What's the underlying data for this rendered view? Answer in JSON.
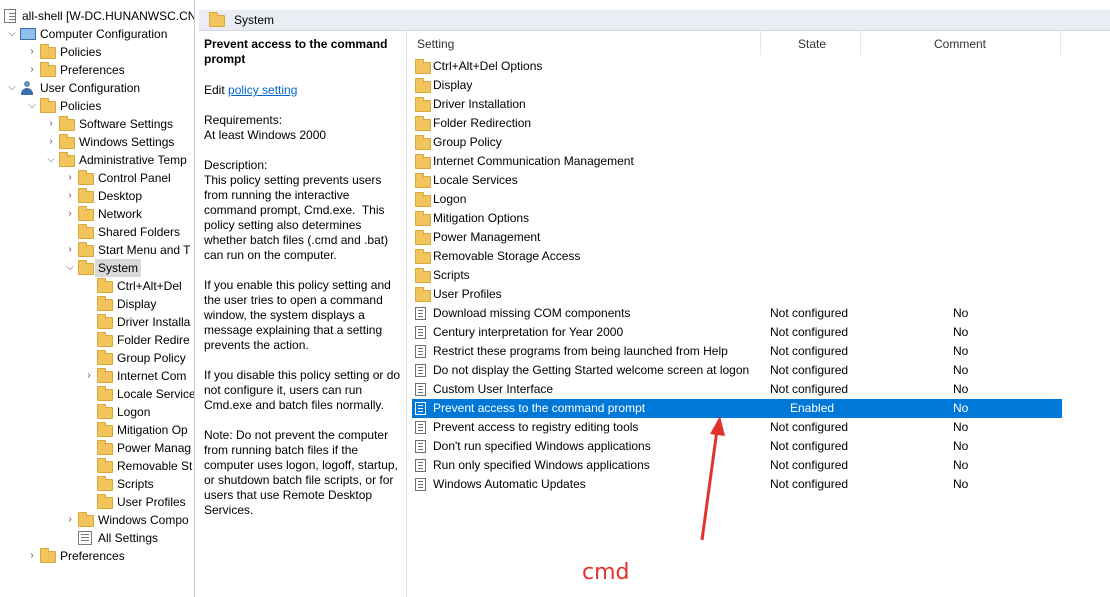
{
  "tree": {
    "root_label": "all-shell [W-DC.HUNANWSC.CN",
    "computer_config": "Computer Configuration",
    "cc_policies": "Policies",
    "cc_preferences": "Preferences",
    "user_config": "User Configuration",
    "uc_policies": "Policies",
    "software_settings": "Software Settings",
    "windows_settings": "Windows Settings",
    "admin_templates": "Administrative Temp",
    "control_panel": "Control Panel",
    "desktop": "Desktop",
    "network": "Network",
    "shared_folders": "Shared Folders",
    "start_menu": "Start Menu and T",
    "system": "System",
    "sys_ctrl_alt_del": "Ctrl+Alt+Del",
    "sys_display": "Display",
    "sys_driver": "Driver Installa",
    "sys_folder_redir": "Folder Redire",
    "sys_group_policy": "Group Policy",
    "sys_internet_comm": "Internet Com",
    "sys_locale": "Locale Service",
    "sys_logon": "Logon",
    "sys_mitigation": "Mitigation Op",
    "sys_power": "Power Manag",
    "sys_removable": "Removable St",
    "sys_scripts": "Scripts",
    "sys_user_profiles": "User Profiles",
    "windows_components": "Windows Compo",
    "all_settings": "All Settings",
    "uc_preferences": "Preferences"
  },
  "header": {
    "title": "System"
  },
  "description": {
    "title": "Prevent access to the command prompt",
    "edit_prefix": "Edit ",
    "edit_link": "policy setting",
    "requirements_label": "Requirements:",
    "requirements_value": "At least Windows 2000",
    "description_label": "Description:",
    "description_text": "This policy setting prevents users from running the interactive command prompt, Cmd.exe.  This policy setting also determines whether batch files (.cmd and .bat) can run on the computer.",
    "enable_text": "If you enable this policy setting and the user tries to open a command window, the system displays a message explaining that a setting prevents the action.",
    "disable_text": "If you disable this policy setting or do not configure it, users can run Cmd.exe and batch files normally.",
    "note_text": "Note: Do not prevent the computer from running batch files if the computer uses logon, logoff, startup, or shutdown batch file scripts, or for users that use Remote Desktop Services."
  },
  "columns": {
    "setting": "Setting",
    "state": "State",
    "comment": "Comment"
  },
  "folders": [
    "Ctrl+Alt+Del Options",
    "Display",
    "Driver Installation",
    "Folder Redirection",
    "Group Policy",
    "Internet Communication Management",
    "Locale Services",
    "Logon",
    "Mitigation Options",
    "Power Management",
    "Removable Storage Access",
    "Scripts",
    "User Profiles"
  ],
  "settings": [
    {
      "name": "Download missing COM components",
      "state": "Not configured",
      "comment": "No"
    },
    {
      "name": "Century interpretation for Year 2000",
      "state": "Not configured",
      "comment": "No"
    },
    {
      "name": "Restrict these programs from being launched from Help",
      "state": "Not configured",
      "comment": "No"
    },
    {
      "name": "Do not display the Getting Started welcome screen at logon",
      "state": "Not configured",
      "comment": "No"
    },
    {
      "name": "Custom User Interface",
      "state": "Not configured",
      "comment": "No"
    },
    {
      "name": "Prevent access to the command prompt",
      "state": "Enabled",
      "comment": "No"
    },
    {
      "name": "Prevent access to registry editing tools",
      "state": "Not configured",
      "comment": "No"
    },
    {
      "name": "Don't run specified Windows applications",
      "state": "Not configured",
      "comment": "No"
    },
    {
      "name": "Run only specified Windows applications",
      "state": "Not configured",
      "comment": "No"
    },
    {
      "name": "Windows Automatic Updates",
      "state": "Not configured",
      "comment": "No"
    }
  ],
  "annotation": {
    "text": "cmd",
    "color": "#e0332d"
  },
  "colors": {
    "selection": "#0078d7",
    "link": "#0066cc"
  }
}
